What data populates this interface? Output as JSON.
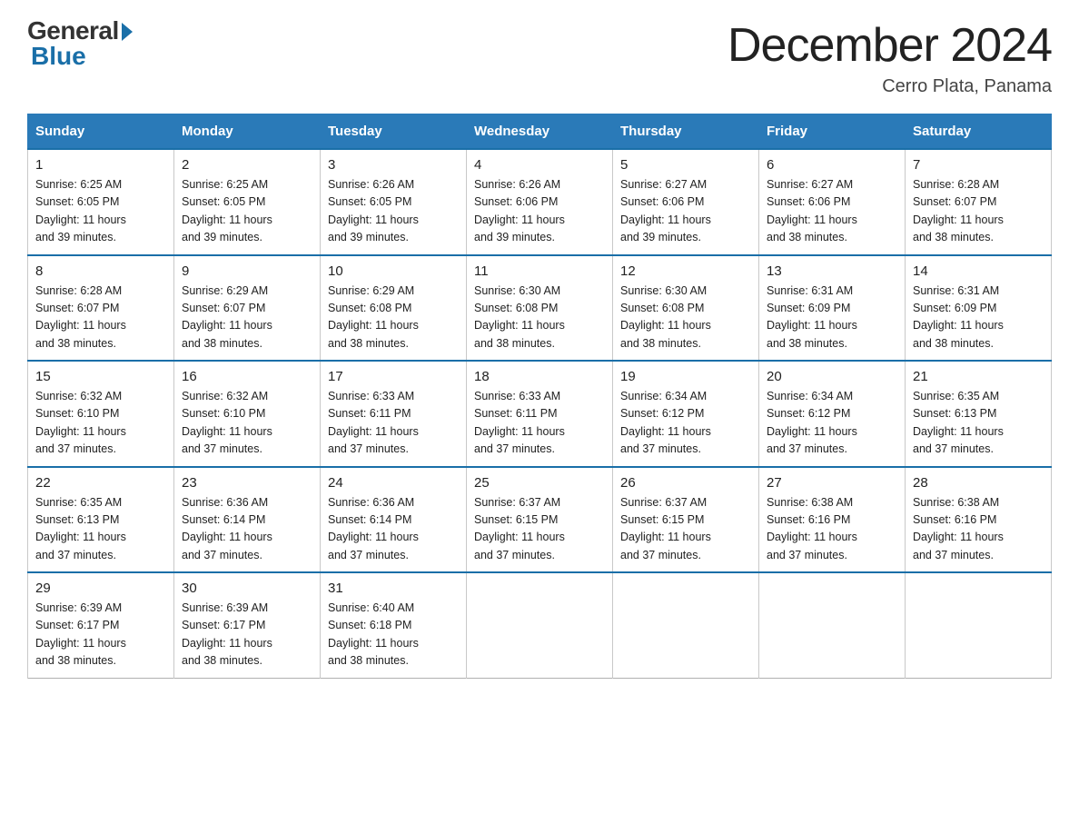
{
  "logo": {
    "general": "General",
    "blue": "Blue"
  },
  "title": "December 2024",
  "location": "Cerro Plata, Panama",
  "days_of_week": [
    "Sunday",
    "Monday",
    "Tuesday",
    "Wednesday",
    "Thursday",
    "Friday",
    "Saturday"
  ],
  "weeks": [
    [
      {
        "day": "1",
        "sunrise": "6:25 AM",
        "sunset": "6:05 PM",
        "daylight": "11 hours and 39 minutes."
      },
      {
        "day": "2",
        "sunrise": "6:25 AM",
        "sunset": "6:05 PM",
        "daylight": "11 hours and 39 minutes."
      },
      {
        "day": "3",
        "sunrise": "6:26 AM",
        "sunset": "6:05 PM",
        "daylight": "11 hours and 39 minutes."
      },
      {
        "day": "4",
        "sunrise": "6:26 AM",
        "sunset": "6:06 PM",
        "daylight": "11 hours and 39 minutes."
      },
      {
        "day": "5",
        "sunrise": "6:27 AM",
        "sunset": "6:06 PM",
        "daylight": "11 hours and 39 minutes."
      },
      {
        "day": "6",
        "sunrise": "6:27 AM",
        "sunset": "6:06 PM",
        "daylight": "11 hours and 38 minutes."
      },
      {
        "day": "7",
        "sunrise": "6:28 AM",
        "sunset": "6:07 PM",
        "daylight": "11 hours and 38 minutes."
      }
    ],
    [
      {
        "day": "8",
        "sunrise": "6:28 AM",
        "sunset": "6:07 PM",
        "daylight": "11 hours and 38 minutes."
      },
      {
        "day": "9",
        "sunrise": "6:29 AM",
        "sunset": "6:07 PM",
        "daylight": "11 hours and 38 minutes."
      },
      {
        "day": "10",
        "sunrise": "6:29 AM",
        "sunset": "6:08 PM",
        "daylight": "11 hours and 38 minutes."
      },
      {
        "day": "11",
        "sunrise": "6:30 AM",
        "sunset": "6:08 PM",
        "daylight": "11 hours and 38 minutes."
      },
      {
        "day": "12",
        "sunrise": "6:30 AM",
        "sunset": "6:08 PM",
        "daylight": "11 hours and 38 minutes."
      },
      {
        "day": "13",
        "sunrise": "6:31 AM",
        "sunset": "6:09 PM",
        "daylight": "11 hours and 38 minutes."
      },
      {
        "day": "14",
        "sunrise": "6:31 AM",
        "sunset": "6:09 PM",
        "daylight": "11 hours and 38 minutes."
      }
    ],
    [
      {
        "day": "15",
        "sunrise": "6:32 AM",
        "sunset": "6:10 PM",
        "daylight": "11 hours and 37 minutes."
      },
      {
        "day": "16",
        "sunrise": "6:32 AM",
        "sunset": "6:10 PM",
        "daylight": "11 hours and 37 minutes."
      },
      {
        "day": "17",
        "sunrise": "6:33 AM",
        "sunset": "6:11 PM",
        "daylight": "11 hours and 37 minutes."
      },
      {
        "day": "18",
        "sunrise": "6:33 AM",
        "sunset": "6:11 PM",
        "daylight": "11 hours and 37 minutes."
      },
      {
        "day": "19",
        "sunrise": "6:34 AM",
        "sunset": "6:12 PM",
        "daylight": "11 hours and 37 minutes."
      },
      {
        "day": "20",
        "sunrise": "6:34 AM",
        "sunset": "6:12 PM",
        "daylight": "11 hours and 37 minutes."
      },
      {
        "day": "21",
        "sunrise": "6:35 AM",
        "sunset": "6:13 PM",
        "daylight": "11 hours and 37 minutes."
      }
    ],
    [
      {
        "day": "22",
        "sunrise": "6:35 AM",
        "sunset": "6:13 PM",
        "daylight": "11 hours and 37 minutes."
      },
      {
        "day": "23",
        "sunrise": "6:36 AM",
        "sunset": "6:14 PM",
        "daylight": "11 hours and 37 minutes."
      },
      {
        "day": "24",
        "sunrise": "6:36 AM",
        "sunset": "6:14 PM",
        "daylight": "11 hours and 37 minutes."
      },
      {
        "day": "25",
        "sunrise": "6:37 AM",
        "sunset": "6:15 PM",
        "daylight": "11 hours and 37 minutes."
      },
      {
        "day": "26",
        "sunrise": "6:37 AM",
        "sunset": "6:15 PM",
        "daylight": "11 hours and 37 minutes."
      },
      {
        "day": "27",
        "sunrise": "6:38 AM",
        "sunset": "6:16 PM",
        "daylight": "11 hours and 37 minutes."
      },
      {
        "day": "28",
        "sunrise": "6:38 AM",
        "sunset": "6:16 PM",
        "daylight": "11 hours and 37 minutes."
      }
    ],
    [
      {
        "day": "29",
        "sunrise": "6:39 AM",
        "sunset": "6:17 PM",
        "daylight": "11 hours and 38 minutes."
      },
      {
        "day": "30",
        "sunrise": "6:39 AM",
        "sunset": "6:17 PM",
        "daylight": "11 hours and 38 minutes."
      },
      {
        "day": "31",
        "sunrise": "6:40 AM",
        "sunset": "6:18 PM",
        "daylight": "11 hours and 38 minutes."
      },
      null,
      null,
      null,
      null
    ]
  ],
  "labels": {
    "sunrise": "Sunrise:",
    "sunset": "Sunset:",
    "daylight": "Daylight:"
  }
}
